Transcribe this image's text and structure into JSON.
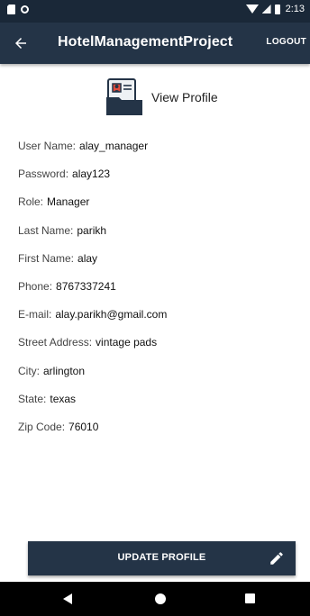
{
  "status_bar": {
    "time": "2:13"
  },
  "app_bar": {
    "title": "HotelManagementProject",
    "logout_label": "LOGOUT"
  },
  "header": {
    "label": "View Profile"
  },
  "profile": [
    {
      "label": "User Name:",
      "value": "alay_manager"
    },
    {
      "label": "Password:",
      "value": "alay123"
    },
    {
      "label": "Role:",
      "value": "Manager"
    },
    {
      "label": "Last Name:",
      "value": "parikh"
    },
    {
      "label": "First Name:",
      "value": "alay"
    },
    {
      "label": "Phone:",
      "value": "8767337241"
    },
    {
      "label": "E-mail:",
      "value": "alay.parikh@gmail.com"
    },
    {
      "label": "Street Address:",
      "value": "vintage pads"
    },
    {
      "label": "City:",
      "value": "arlington"
    },
    {
      "label": "State:",
      "value": "texas"
    },
    {
      "label": "Zip Code:",
      "value": "76010"
    }
  ],
  "update_button": {
    "label": "UPDATE PROFILE"
  },
  "colors": {
    "app_bar": "#243447",
    "status_bar": "#1a2838",
    "button": "#243447",
    "nav_bar": "#000000"
  },
  "icons": {
    "back": "arrow-left-icon",
    "profile": "profile-card-icon",
    "edit": "pencil-icon",
    "nav_back": "triangle-back-icon",
    "nav_home": "circle-home-icon",
    "nav_recents": "square-recents-icon"
  }
}
